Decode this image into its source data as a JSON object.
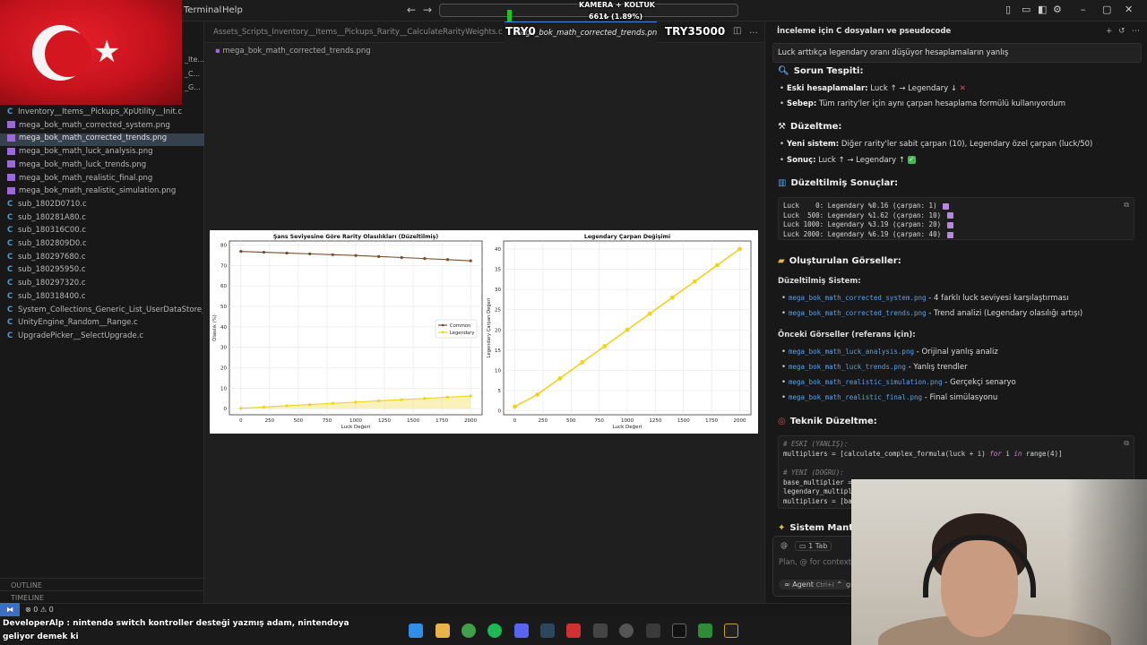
{
  "menu": {
    "terminal": "Terminal",
    "help": "Help"
  },
  "overlay": {
    "top_label": "KAMERA + KOLTUK",
    "counter": "661₺ (1.89%)",
    "left_amount": "TRY0",
    "right_amount": "TRY35000"
  },
  "explorer": {
    "clipped_items": [
      "_Ite...",
      "_C...",
      "_G..."
    ],
    "items": [
      {
        "icon": "c",
        "label": "Inventory__Items__Pickups_XpUtility__Init.c"
      },
      {
        "icon": "img",
        "label": "mega_bok_math_corrected_system.png"
      },
      {
        "icon": "img",
        "label": "mega_bok_math_corrected_trends.png",
        "selected": true
      },
      {
        "icon": "img",
        "label": "mega_bok_math_luck_analysis.png"
      },
      {
        "icon": "img",
        "label": "mega_bok_math_luck_trends.png"
      },
      {
        "icon": "img",
        "label": "mega_bok_math_realistic_final.png"
      },
      {
        "icon": "img",
        "label": "mega_bok_math_realistic_simulation.png"
      },
      {
        "icon": "c",
        "label": "sub_1802D0710.c"
      },
      {
        "icon": "c",
        "label": "sub_180281A80.c"
      },
      {
        "icon": "c",
        "label": "sub_180316C00.c"
      },
      {
        "icon": "c",
        "label": "sub_1802809D0.c"
      },
      {
        "icon": "c",
        "label": "sub_180297680.c"
      },
      {
        "icon": "c",
        "label": "sub_180295950.c"
      },
      {
        "icon": "c",
        "label": "sub_180297320.c"
      },
      {
        "icon": "c",
        "label": "sub_180318400.c"
      },
      {
        "icon": "c",
        "label": "System_Collections_Generic_List_UserDataStore_Pla..."
      },
      {
        "icon": "c",
        "label": "UnityEngine_Random__Range.c"
      },
      {
        "icon": "c",
        "label": "UpgradePicker__SelectUpgrade.c"
      }
    ],
    "outline": "OUTLINE",
    "timeline": "TIMELINE"
  },
  "editor": {
    "tabs": [
      {
        "label": "Assets_Scripts_Inventory__Items__Pickups_Rarity__CalculateRarityWeights.c",
        "active": false
      },
      {
        "label": "mega_bok_math_corrected_trends.png",
        "active": true
      }
    ],
    "breadcrumb": "mega_bok_math_corrected_trends.png"
  },
  "chart_data": [
    {
      "type": "line",
      "title": "Şans Seviyesine Göre Rarity Olasılıkları (Düzeltilmiş)",
      "xlabel": "Luck Değeri",
      "ylabel": "Olasılık (%)",
      "x": [
        0,
        200,
        400,
        600,
        800,
        1000,
        1200,
        1400,
        1600,
        1800,
        2000
      ],
      "xticks": [
        "0",
        "250",
        "500",
        "750",
        "1000",
        "1250",
        "1500",
        "1750",
        "2000"
      ],
      "yticks": [
        "0",
        "10",
        "20",
        "30",
        "40",
        "50",
        "60",
        "70",
        "80"
      ],
      "xlim": [
        -100,
        2100
      ],
      "ylim": [
        -3,
        82
      ],
      "grid": true,
      "legend_position": "center-right",
      "series": [
        {
          "name": "Common",
          "color": "#7a4a2a",
          "values": [
            76.9,
            76.5,
            76.1,
            75.7,
            75.3,
            74.9,
            74.4,
            73.9,
            73.4,
            72.9,
            72.3
          ]
        },
        {
          "name": "Legendary",
          "color": "#f2d21b",
          "values": [
            0.16,
            0.8,
            1.4,
            2.0,
            2.6,
            3.19,
            3.8,
            4.4,
            5.0,
            5.6,
            6.19
          ]
        }
      ]
    },
    {
      "type": "line",
      "title": "Legendary Çarpan Değişimi",
      "xlabel": "Luck Değeri",
      "ylabel": "Legendary Çarpan Değeri",
      "x": [
        0,
        200,
        400,
        600,
        800,
        1000,
        1200,
        1400,
        1600,
        1800,
        2000
      ],
      "xticks": [
        "0",
        "250",
        "500",
        "750",
        "1000",
        "1250",
        "1500",
        "1750",
        "2000"
      ],
      "yticks": [
        "0",
        "5",
        "10",
        "15",
        "20",
        "25",
        "30",
        "35",
        "40"
      ],
      "xlim": [
        -100,
        2100
      ],
      "ylim": [
        -1,
        42
      ],
      "grid": true,
      "series": [
        {
          "name": "",
          "color": "#f2d21b",
          "values": [
            1,
            4,
            8,
            12,
            16,
            20,
            24,
            28,
            32,
            36,
            40
          ]
        }
      ]
    }
  ],
  "chat": {
    "title": "İnceleme için C dosyaları ve pseudocode",
    "intro": "Luck arttıkça legendary oranı düşüyor hesaplamaların yanlış",
    "h_problem": "Sorun Tespiti:",
    "b1_label": "Eski hesaplamalar:",
    "b1_text": "Luck ↑ → Legendary ↓",
    "b2_label": "Sebep:",
    "b2_text": "Tüm rarity'ler için aynı çarpan hesaplama formülü kullanıyordum",
    "h_fix": "Düzeltme:",
    "b3_label": "Yeni sistem:",
    "b3_text": "Diğer rarity'ler sabit çarpan (10), Legendary özel çarpan (luck/50)",
    "b4_label": "Sonuç:",
    "b4_text": "Luck ↑ → Legendary ↑",
    "h_results": "Düzeltilmiş Sonuçlar:",
    "results": [
      "Luck    0: Legendary %0.16 (çarpan: 1)",
      "Luck  500: Legendary %1.62 (çarpan: 10)",
      "Luck 1000: Legendary %3.19 (çarpan: 20)",
      "Luck 2000: Legendary %6.19 (çarpan: 40)"
    ],
    "h_images": "Oluşturulan Görseller:",
    "sub_fixed": "Düzeltilmiş Sistem:",
    "fixed_files": [
      {
        "file": "mega_bok_math_corrected_system.png",
        "desc": " - 4 farklı luck seviyesi karşılaştırması"
      },
      {
        "file": "mega_bok_math_corrected_trends.png",
        "desc": " - Trend analizi (Legendary olasılığı artışı)"
      }
    ],
    "sub_prev": "Önceki Görseller (referans için):",
    "prev_files": [
      {
        "file": "mega_bok_math_luck_analysis.png",
        "desc": " - Orijinal yanlış analiz"
      },
      {
        "file": "mega_bok_math_luck_trends.png",
        "desc": " - Yanlış trendler"
      },
      {
        "file": "mega_bok_math_realistic_simulation.png",
        "desc": " - Gerçekçi senaryo"
      },
      {
        "file": "mega_bok_math_realistic_final.png",
        "desc": " - Final simülasyonu"
      }
    ],
    "h_tech": "Teknik Düzeltme:",
    "code": {
      "c1": "# ESKİ (YANLIŞ):",
      "l1a": "multipliers = [calculate_complex_formula(luck + i) ",
      "l1kw": "for",
      "l1b": " i ",
      "l1kw2": "in",
      "l1c": " range(4)]",
      "c2": "# YENİ (DOĞRU):",
      "l2": "base_multiplier = ",
      "l3": "legendary_multipli",
      "l4": "multipliers = [bas"
    },
    "h_logic": "Sistem Mantığı",
    "tab_count": "1 Tab",
    "input_placeholder": "Plan, @ for context, / ",
    "agent_label": "Agent",
    "agent_shortcut": "Ctrl+I",
    "trailing": "gr"
  },
  "stream_chat": {
    "user": "DeveloperAlp",
    "message_line1": " : nintendo switch kontroller desteği yazmış adam, nintendoya",
    "message_line2": "geliyor demek ki"
  },
  "statusbar": {
    "problems": "⊗ 0 ⚠ 0"
  }
}
